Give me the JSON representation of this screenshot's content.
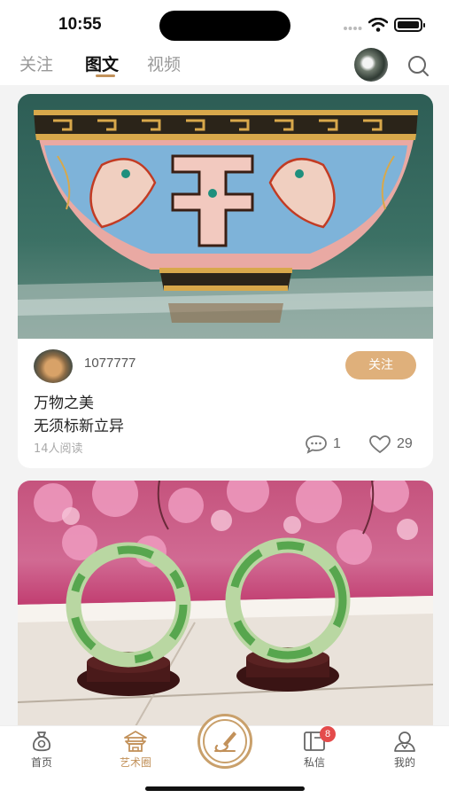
{
  "status_bar": {
    "time": "10:55"
  },
  "header": {
    "tabs": [
      {
        "label": "关注",
        "active": false
      },
      {
        "label": "图文",
        "active": true
      },
      {
        "label": "视频",
        "active": false
      }
    ],
    "accent_color": "#c2915a"
  },
  "posts": [
    {
      "image": "enamel-painted-bowl-photo",
      "author": "1077777",
      "follow_label": "关注",
      "lines": [
        "万物之美",
        "无须标新立异"
      ],
      "read_count": "14人阅读",
      "comments": "1",
      "likes": "29"
    },
    {
      "image": "jade-bangles-photo"
    }
  ],
  "bottom_nav": {
    "items": [
      {
        "label": "首页",
        "icon": "money-bag-icon",
        "active": false
      },
      {
        "label": "艺术圈",
        "icon": "pavilion-icon",
        "active": true
      },
      {
        "label": "私信",
        "icon": "message-book-icon",
        "active": false,
        "badge": "8"
      },
      {
        "label": "我的",
        "icon": "user-icon",
        "active": false
      }
    ],
    "center_icon": "brush-publish-icon"
  }
}
